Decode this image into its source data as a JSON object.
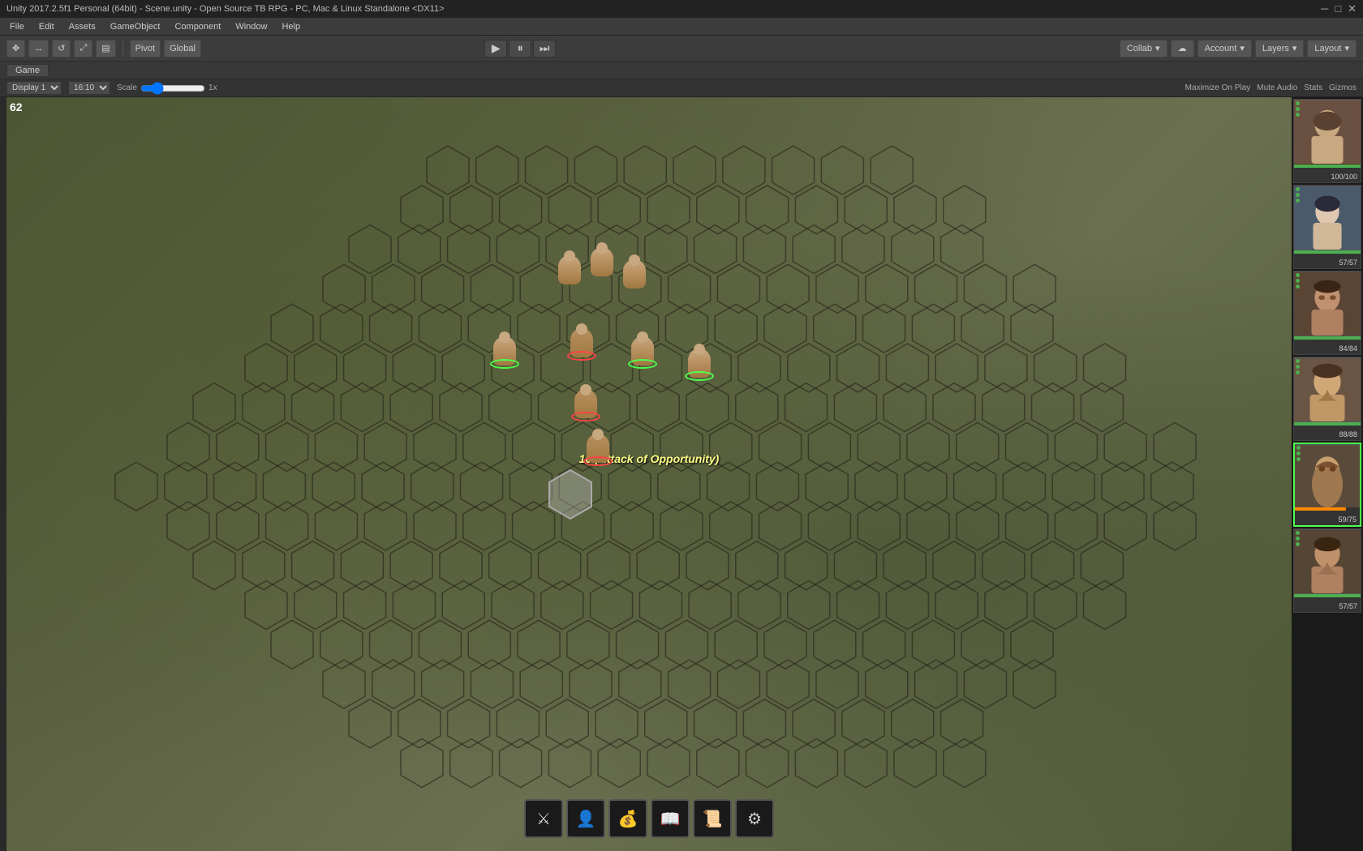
{
  "title_bar": {
    "text": "Unity 2017.2.5f1 Personal (64bit) - Scene.unity - Open Source TB RPG - PC, Mac & Linux Standalone <DX11>",
    "minimize": "─",
    "maximize": "□",
    "close": "✕"
  },
  "menu": {
    "items": [
      "File",
      "Edit",
      "Assets",
      "GameObject",
      "Component",
      "Window",
      "Help"
    ]
  },
  "toolbar": {
    "tools": [
      "✥",
      "↔",
      "↺",
      "⤢",
      "▤"
    ],
    "pivot_label": "Pivot",
    "global_label": "Global"
  },
  "play_controls": {
    "play": "▶",
    "pause": "⏸",
    "step": "⏭"
  },
  "right_toolbar": {
    "collab": "Collab",
    "cloud": "☁",
    "account": "Account",
    "layers": "Layers",
    "layout": "Layout"
  },
  "game_header": {
    "tab": "Game"
  },
  "game_controls": {
    "display_label": "Display 1",
    "resolution": "16:10",
    "scale_label": "Scale",
    "scale_value": "1x",
    "maximize": "Maximize On Play",
    "mute": "Mute Audio",
    "stats": "Stats",
    "gizmos": "Gizmos"
  },
  "frame": {
    "number": "62"
  },
  "combat": {
    "text": "16 (Attack of Opportunity)"
  },
  "characters": [
    {
      "id": "char1",
      "face_color": "#8a7060",
      "hp_current": 100,
      "hp_max": 100,
      "hp_label": "100/100",
      "active": false
    },
    {
      "id": "char2",
      "face_color": "#7a8090",
      "hp_current": 57,
      "hp_max": 57,
      "hp_label": "57/57",
      "active": false
    },
    {
      "id": "char3",
      "face_color": "#9a7560",
      "hp_current": 84,
      "hp_max": 84,
      "hp_label": "84/84",
      "active": false
    },
    {
      "id": "char4",
      "face_color": "#c09070",
      "hp_current": 88,
      "hp_max": 88,
      "hp_label": "88/88",
      "active": false
    },
    {
      "id": "char5",
      "face_color": "#b08868",
      "hp_current": 59,
      "hp_max": 75,
      "hp_label": "59/75",
      "active": true
    },
    {
      "id": "char6",
      "face_color": "#8a7565",
      "hp_current": 57,
      "hp_max": 57,
      "hp_label": "57/57",
      "active": false
    }
  ],
  "action_buttons": [
    {
      "id": "sword",
      "icon": "⚔",
      "label": "Attack"
    },
    {
      "id": "person",
      "icon": "👤",
      "label": "Character"
    },
    {
      "id": "bag",
      "icon": "💰",
      "label": "Inventory"
    },
    {
      "id": "book",
      "icon": "📖",
      "label": "Abilities"
    },
    {
      "id": "scroll",
      "icon": "📜",
      "label": "Journal"
    },
    {
      "id": "gear",
      "icon": "⚙",
      "label": "Settings"
    }
  ],
  "colors": {
    "hp_full": "#4caf50",
    "hp_low": "#ff5555",
    "char_active_border": "#4cff4c",
    "ring_green": "#4cff4c",
    "ring_red": "#ff4444"
  }
}
